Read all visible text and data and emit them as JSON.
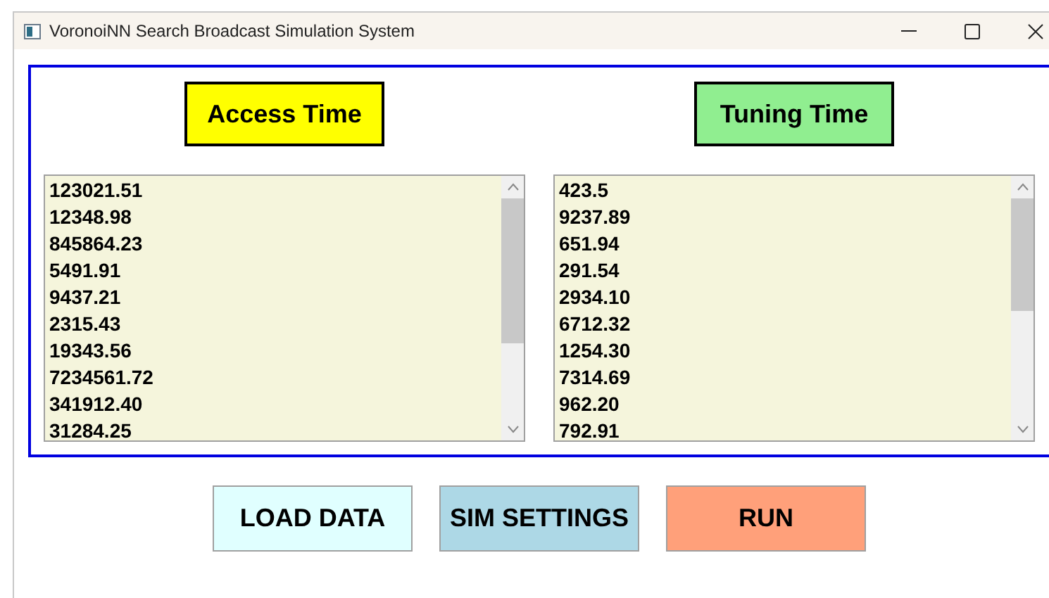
{
  "window": {
    "title": "VoronoiNN Search Broadcast Simulation System"
  },
  "panels": [
    {
      "header": "Access Time",
      "color": "#ffff00",
      "values": [
        "123021.51",
        "12348.98",
        "845864.23",
        "5491.91",
        "9437.21",
        "2315.43",
        "19343.56",
        "7234561.72",
        "341912.40",
        "31284.25"
      ]
    },
    {
      "header": "Tuning Time",
      "color": "#90ee90",
      "values": [
        "423.5",
        "9237.89",
        "651.94",
        "291.54",
        "2934.10",
        "6712.32",
        "1254.30",
        "7314.69",
        "962.20",
        "792.91"
      ]
    }
  ],
  "buttons": [
    {
      "label": "LOAD DATA",
      "color": "#e0ffff"
    },
    {
      "label": "SIM SETTINGS",
      "color": "#add8e6"
    },
    {
      "label": "RUN",
      "color": "#ffa07a"
    }
  ]
}
